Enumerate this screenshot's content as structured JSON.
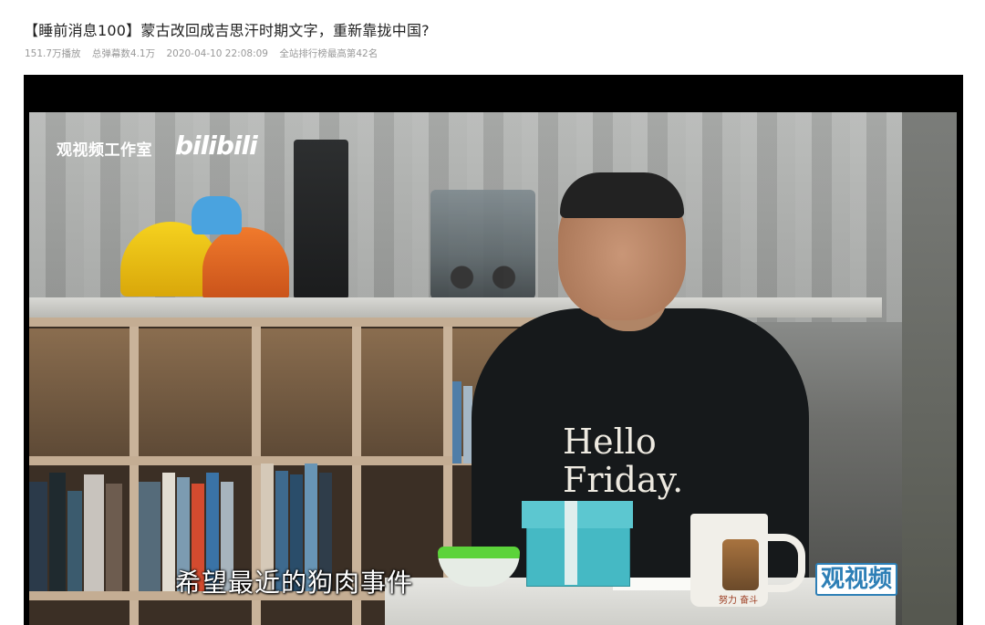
{
  "video": {
    "title": "【睡前消息100】蒙古改回成吉思汗时期文字，重新靠拢中国?",
    "meta": {
      "plays": "151.7万播放",
      "danmaku": "总弹幕数4.1万",
      "datetime": "2020-04-10 22:08:09",
      "rank": "全站排行榜最高第42名"
    }
  },
  "player": {
    "watermark_studio": "观视频工作室",
    "watermark_bili": "bilibili",
    "subtitle": "希望最近的狗肉事件",
    "corner_logo": "观视频",
    "shirt_text": "Hello\nFriday.",
    "mug_text": "努力 奋斗"
  }
}
